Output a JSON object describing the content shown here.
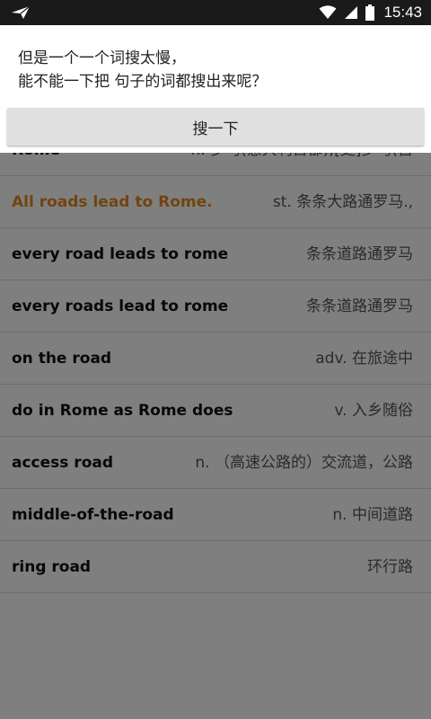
{
  "status_bar": {
    "time": "15:43",
    "icons": [
      "app-send-icon",
      "wifi-icon",
      "signal-icon",
      "battery-icon"
    ]
  },
  "tip": {
    "line1": "但是一个一个词搜太慢，",
    "line2": "能不能一下把 句子的词都搜出来呢？",
    "button_label": "搜一下"
  },
  "results": [
    {
      "en": "Rome",
      "zh": "n. 罗马(意大利首都);[史]罗马(古"
    },
    {
      "en": "All roads lead to Rome.",
      "zh": "st. 条条大路通罗马.,",
      "highlight": true
    },
    {
      "en": "every road leads to rome",
      "zh": "条条道路通罗马"
    },
    {
      "en": "every roads lead to rome",
      "zh": "条条道路通罗马"
    },
    {
      "en": "on the road",
      "zh": "adv. 在旅途中"
    },
    {
      "en": "do in Rome as Rome does",
      "zh": "v. 入乡随俗"
    },
    {
      "en": "access road",
      "zh": "n. （高速公路的）交流道，公路"
    },
    {
      "en": "middle-of-the-road",
      "zh": "n. 中间道路"
    },
    {
      "en": "ring road",
      "zh": "环行路"
    }
  ],
  "colors": {
    "status_bar_bg": "#1a1a1a",
    "highlight_text": "#e38b1e",
    "overlay": "rgba(0,0,0,0.5)"
  }
}
